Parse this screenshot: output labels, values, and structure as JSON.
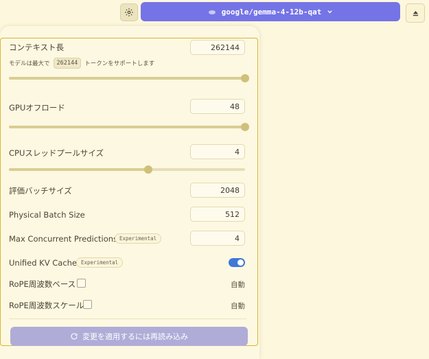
{
  "topbar": {
    "model_name": "google/gemma-4-12b-qat"
  },
  "settings": {
    "context_length": {
      "label": "コンテキスト長",
      "value": "262144",
      "hint_prefix": "モデルは最大で",
      "hint_value": "262144",
      "hint_suffix": "トークンをサポートします",
      "slider_fraction": 1.0
    },
    "gpu_offload": {
      "label": "GPUオフロード",
      "value": "48",
      "slider_fraction": 1.0
    },
    "cpu_threads": {
      "label": "CPUスレッドプールサイズ",
      "value": "4",
      "slider_fraction": 0.59
    },
    "eval_batch": {
      "label": "評価バッチサイズ",
      "value": "2048"
    },
    "physical_batch": {
      "label": "Physical Batch Size",
      "value": "512"
    },
    "max_concurrent": {
      "label": "Max Concurrent Predictions",
      "badge": "Experimental",
      "value": "4"
    },
    "unified_kv": {
      "label": "Unified KV Cache",
      "badge": "Experimental",
      "enabled": true
    },
    "rope_base": {
      "label": "RoPE周波数ベース",
      "value": "自動"
    },
    "rope_scale": {
      "label": "RoPE周波数スケール",
      "value": "自動"
    }
  },
  "apply_button": {
    "label": "変更を適用するには再読み込み"
  },
  "colors": {
    "accent": "#7574e6",
    "toggle_on": "#3f78d8",
    "panel_border": "#d8b530"
  }
}
